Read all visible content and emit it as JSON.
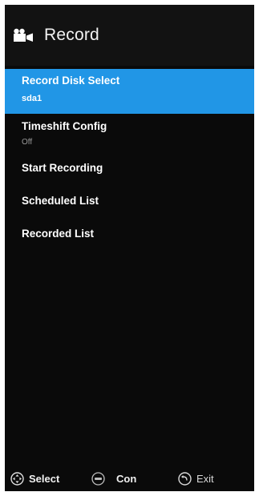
{
  "header": {
    "icon": "video-camera-icon",
    "title": "Record"
  },
  "menu": {
    "items": [
      {
        "label": "Record Disk Select",
        "value": "sda1",
        "selected": true
      },
      {
        "label": "Timeshift Config",
        "value": "Off",
        "selected": false
      },
      {
        "label": "Start Recording",
        "selected": false
      },
      {
        "label": "Scheduled List",
        "selected": false
      },
      {
        "label": "Recorded List",
        "selected": false
      }
    ]
  },
  "footer": {
    "select": {
      "icon": "dpad-icon",
      "label": "Select"
    },
    "confirm": {
      "icon": "enter-icon",
      "label": "Con"
    },
    "exit": {
      "icon": "return-icon",
      "label": "Exit"
    }
  },
  "colors": {
    "background": "#0a0a0a",
    "highlight": "#2196e6",
    "text": "#ffffff",
    "value_dim": "#9a9a9a"
  }
}
